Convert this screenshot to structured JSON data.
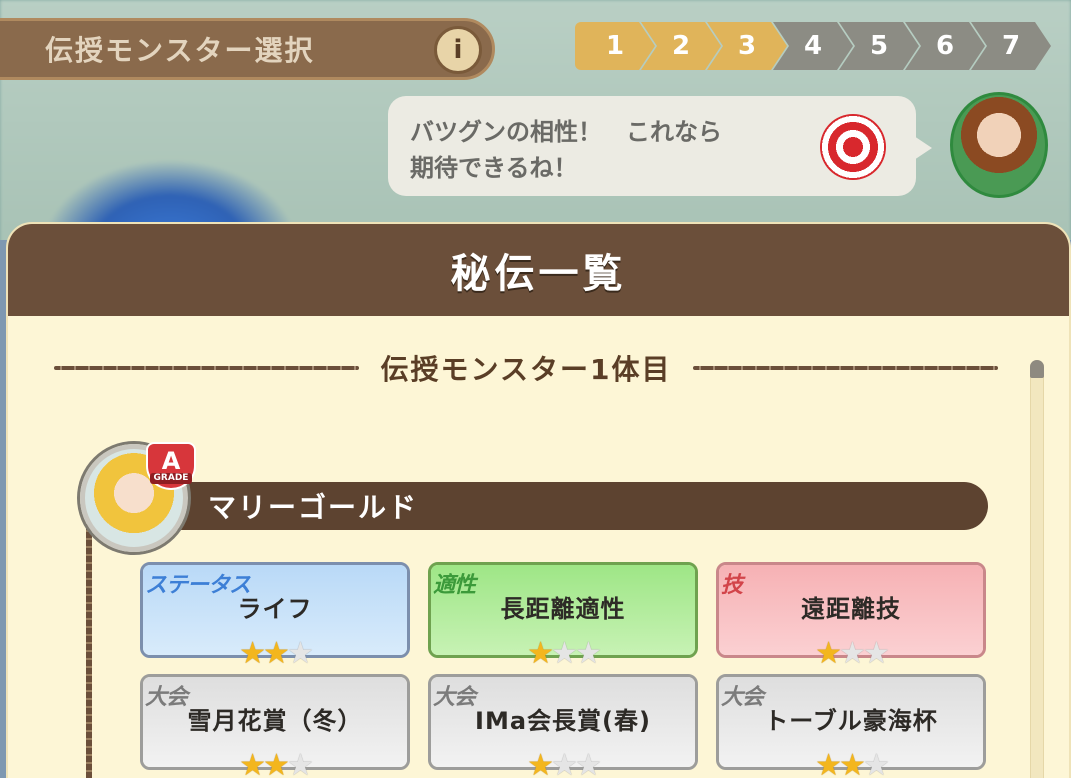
{
  "top_bar": {
    "title": "伝授モンスター選択",
    "info_label": "i",
    "steps": [
      {
        "label": "1",
        "state": "done"
      },
      {
        "label": "2",
        "state": "done"
      },
      {
        "label": "3",
        "state": "done"
      },
      {
        "label": "4",
        "state": "todo"
      },
      {
        "label": "5",
        "state": "todo"
      },
      {
        "label": "6",
        "state": "todo"
      },
      {
        "label": "7",
        "state": "todo"
      }
    ]
  },
  "speech_bubble": {
    "line1": "バツグンの相性！　これなら",
    "line2": "期待できるね！",
    "icon": "target-icon"
  },
  "modal": {
    "title": "秘伝一覧",
    "section_title": "伝授モンスター1体目",
    "monster": {
      "name": "マリーゴールド",
      "grade": "A",
      "grade_caption": "GRADE"
    },
    "cards": [
      {
        "category": "ステータス",
        "label": "ライフ",
        "color": "blue",
        "stars": 2,
        "max_stars": 3
      },
      {
        "category": "適性",
        "label": "長距離適性",
        "color": "green",
        "stars": 1,
        "max_stars": 3
      },
      {
        "category": "技",
        "label": "遠距離技",
        "color": "pink",
        "stars": 1,
        "max_stars": 3
      },
      {
        "category": "大会",
        "label": "雪月花賞（冬）",
        "color": "gray",
        "stars": 2,
        "max_stars": 3
      },
      {
        "category": "大会",
        "label": "IMa会長賞(春)",
        "color": "gray",
        "stars": 1,
        "max_stars": 3
      },
      {
        "category": "大会",
        "label": "トーブル豪海杯",
        "color": "gray",
        "stars": 2,
        "max_stars": 3
      }
    ]
  },
  "colors": {
    "modal_header": "#6b4f3a",
    "modal_body": "#fdf6d6",
    "step_done": "#e0b45a",
    "step_todo": "#8c8c84",
    "star_on": "#f3b61e"
  }
}
